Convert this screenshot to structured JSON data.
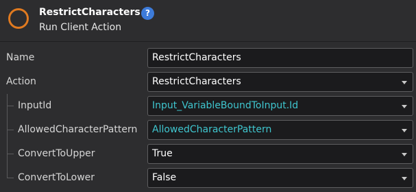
{
  "header": {
    "icon": "client-action-ring-icon",
    "title": "RestrictCharacters",
    "help_label": "?",
    "subtitle": "Run Client Action"
  },
  "colors": {
    "background": "#2d2d2f",
    "field_background": "#1b1b1d",
    "accent_ring": "#e07a20",
    "help_badge": "#3d7bd9",
    "expression_text": "#3fc6cf"
  },
  "properties": [
    {
      "label": "Name",
      "value": "RestrictCharacters",
      "kind": "text"
    },
    {
      "label": "Action",
      "value": "RestrictCharacters",
      "kind": "dropdown"
    },
    {
      "label": "InputId",
      "value": "Input_VariableBoundToInput.Id",
      "kind": "dropdown",
      "expression": true
    },
    {
      "label": "AllowedCharacterPattern",
      "value": "AllowedCharacterPattern",
      "kind": "dropdown",
      "expression": true
    },
    {
      "label": "ConvertToUpper",
      "value": "True",
      "kind": "dropdown"
    },
    {
      "label": "ConvertToLower",
      "value": "False",
      "kind": "dropdown"
    }
  ]
}
